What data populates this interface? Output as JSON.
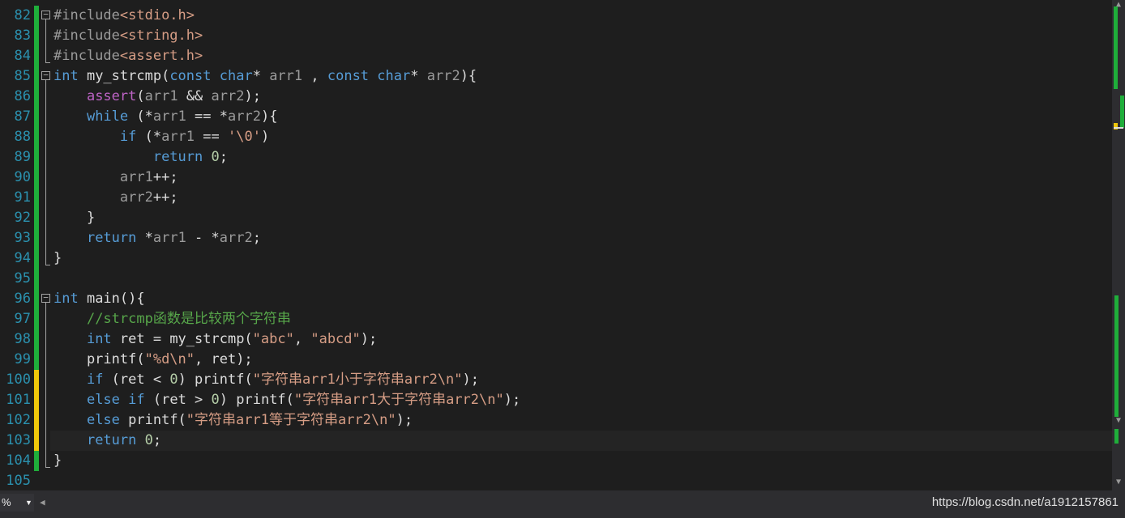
{
  "editor": {
    "lines": [
      {
        "num": "82",
        "bar": "green",
        "fold": "minus",
        "segments": [
          [
            "pp",
            "#include"
          ],
          [
            "inc",
            "<stdio.h>"
          ]
        ]
      },
      {
        "num": "83",
        "bar": "green",
        "fold": "line",
        "segments": [
          [
            "pp",
            "#include"
          ],
          [
            "inc",
            "<string.h>"
          ]
        ]
      },
      {
        "num": "84",
        "bar": "green",
        "fold": "end",
        "segments": [
          [
            "pp",
            "#include"
          ],
          [
            "inc",
            "<assert.h>"
          ]
        ]
      },
      {
        "num": "85",
        "bar": "green",
        "fold": "minus",
        "segments": [
          [
            "kw",
            "int"
          ],
          [
            "fn",
            " my_strcmp("
          ],
          [
            "kw",
            "const"
          ],
          [
            "fn",
            " "
          ],
          [
            "kw",
            "char"
          ],
          [
            "fn",
            "* "
          ],
          [
            "pp",
            "arr1"
          ],
          [
            "fn",
            " , "
          ],
          [
            "kw",
            "const"
          ],
          [
            "fn",
            " "
          ],
          [
            "kw",
            "char"
          ],
          [
            "fn",
            "* "
          ],
          [
            "pp",
            "arr2"
          ],
          [
            "fn",
            "){"
          ]
        ]
      },
      {
        "num": "86",
        "bar": "green",
        "fold": "line",
        "segments": [
          [
            "fn",
            "    "
          ],
          [
            "mac",
            "assert"
          ],
          [
            "fn",
            "("
          ],
          [
            "pp",
            "arr1"
          ],
          [
            "fn",
            " && "
          ],
          [
            "pp",
            "arr2"
          ],
          [
            "fn",
            ");"
          ]
        ]
      },
      {
        "num": "87",
        "bar": "green",
        "fold": "line",
        "segments": [
          [
            "fn",
            "    "
          ],
          [
            "kw",
            "while"
          ],
          [
            "fn",
            " (*"
          ],
          [
            "pp",
            "arr1"
          ],
          [
            "fn",
            " == *"
          ],
          [
            "pp",
            "arr2"
          ],
          [
            "fn",
            "){"
          ]
        ]
      },
      {
        "num": "88",
        "bar": "green",
        "fold": "line",
        "segments": [
          [
            "fn",
            "        "
          ],
          [
            "kw",
            "if"
          ],
          [
            "fn",
            " (*"
          ],
          [
            "pp",
            "arr1"
          ],
          [
            "fn",
            " == "
          ],
          [
            "str",
            "'\\0'"
          ],
          [
            "fn",
            ")"
          ]
        ]
      },
      {
        "num": "89",
        "bar": "green",
        "fold": "line",
        "segments": [
          [
            "fn",
            "            "
          ],
          [
            "kw",
            "return"
          ],
          [
            "fn",
            " "
          ],
          [
            "num",
            "0"
          ],
          [
            "fn",
            ";"
          ]
        ]
      },
      {
        "num": "90",
        "bar": "green",
        "fold": "line",
        "segments": [
          [
            "fn",
            "        "
          ],
          [
            "pp",
            "arr1"
          ],
          [
            "fn",
            "++;"
          ]
        ]
      },
      {
        "num": "91",
        "bar": "green",
        "fold": "line",
        "segments": [
          [
            "fn",
            "        "
          ],
          [
            "pp",
            "arr2"
          ],
          [
            "fn",
            "++;"
          ]
        ]
      },
      {
        "num": "92",
        "bar": "green",
        "fold": "line",
        "segments": [
          [
            "fn",
            "    }"
          ]
        ]
      },
      {
        "num": "93",
        "bar": "green",
        "fold": "line",
        "segments": [
          [
            "fn",
            "    "
          ],
          [
            "kw",
            "return"
          ],
          [
            "fn",
            " *"
          ],
          [
            "pp",
            "arr1"
          ],
          [
            "fn",
            " - *"
          ],
          [
            "pp",
            "arr2"
          ],
          [
            "fn",
            ";"
          ]
        ]
      },
      {
        "num": "94",
        "bar": "green",
        "fold": "end",
        "segments": [
          [
            "fn",
            "}"
          ]
        ]
      },
      {
        "num": "95",
        "bar": "green",
        "fold": "none",
        "segments": []
      },
      {
        "num": "96",
        "bar": "green",
        "fold": "minus",
        "segments": [
          [
            "kw",
            "int"
          ],
          [
            "fn",
            " main(){"
          ]
        ]
      },
      {
        "num": "97",
        "bar": "green",
        "fold": "line",
        "segments": [
          [
            "fn",
            "    "
          ],
          [
            "cmt",
            "//strcmp函数是比较两个字符串"
          ]
        ]
      },
      {
        "num": "98",
        "bar": "green",
        "fold": "line",
        "segments": [
          [
            "fn",
            "    "
          ],
          [
            "kw",
            "int"
          ],
          [
            "fn",
            " ret = my_strcmp("
          ],
          [
            "str",
            "\"abc\""
          ],
          [
            "fn",
            ", "
          ],
          [
            "str",
            "\"abcd\""
          ],
          [
            "fn",
            ");"
          ]
        ]
      },
      {
        "num": "99",
        "bar": "green",
        "fold": "line",
        "segments": [
          [
            "fn",
            "    printf("
          ],
          [
            "str",
            "\"%d\\n\""
          ],
          [
            "fn",
            ", ret);"
          ]
        ]
      },
      {
        "num": "100",
        "bar": "yellow",
        "fold": "line",
        "segments": [
          [
            "fn",
            "    "
          ],
          [
            "kw",
            "if"
          ],
          [
            "fn",
            " (ret < "
          ],
          [
            "num",
            "0"
          ],
          [
            "fn",
            ") printf("
          ],
          [
            "str",
            "\"字符串arr1小于字符串arr2\\n\""
          ],
          [
            "fn",
            ");"
          ]
        ]
      },
      {
        "num": "101",
        "bar": "yellow",
        "fold": "line",
        "segments": [
          [
            "fn",
            "    "
          ],
          [
            "kw",
            "else"
          ],
          [
            "fn",
            " "
          ],
          [
            "kw",
            "if"
          ],
          [
            "fn",
            " (ret > "
          ],
          [
            "num",
            "0"
          ],
          [
            "fn",
            ") printf("
          ],
          [
            "str",
            "\"字符串arr1大于字符串arr2\\n\""
          ],
          [
            "fn",
            ");"
          ]
        ]
      },
      {
        "num": "102",
        "bar": "yellow",
        "fold": "line",
        "segments": [
          [
            "fn",
            "    "
          ],
          [
            "kw",
            "else"
          ],
          [
            "fn",
            " printf("
          ],
          [
            "str",
            "\"字符串arr1等于字符串arr2\\n\""
          ],
          [
            "fn",
            ");"
          ]
        ]
      },
      {
        "num": "103",
        "bar": "yellow",
        "fold": "line",
        "current": true,
        "segments": [
          [
            "fn",
            "    "
          ],
          [
            "kw",
            "return"
          ],
          [
            "fn",
            " "
          ],
          [
            "num",
            "0"
          ],
          [
            "fn",
            ";"
          ]
        ]
      },
      {
        "num": "104",
        "bar": "green",
        "fold": "end",
        "segments": [
          [
            "fn",
            "}"
          ]
        ]
      },
      {
        "num": "105",
        "bar": "none",
        "fold": "none",
        "segments": []
      }
    ]
  },
  "colors": {
    "background": "#1e1e1e",
    "line_number": "#2b91af",
    "keyword": "#569cd6",
    "string": "#d69d85",
    "comment": "#57a64a",
    "changed_saved": "#1fae3a",
    "changed_unsaved": "#efc70a"
  },
  "zoom": {
    "value": "%"
  },
  "watermark": "https://blog.csdn.net/a1912157861"
}
